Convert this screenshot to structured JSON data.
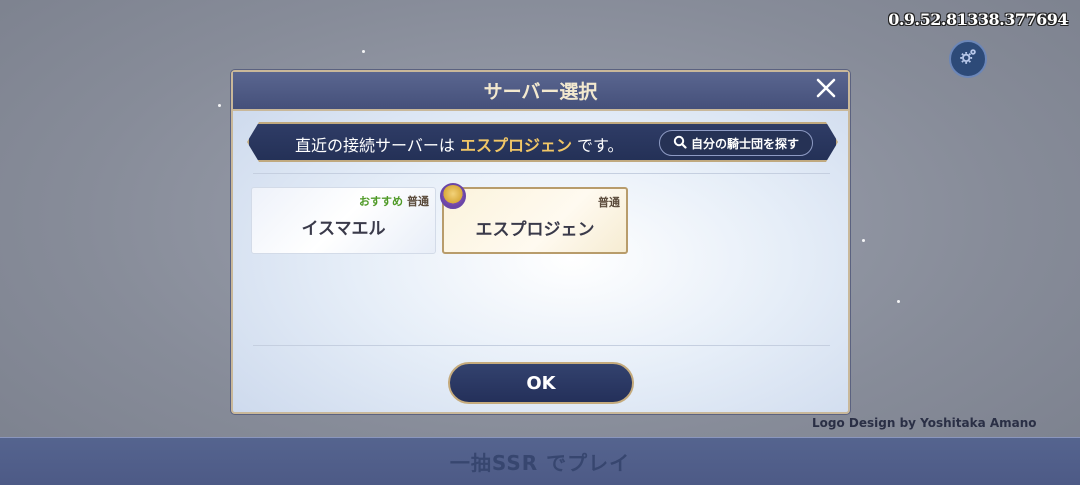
{
  "version": "0.9.52.81338.377694",
  "settings": {
    "icon": "gear-icon"
  },
  "dialog": {
    "title": "サーバー選択",
    "close_icon": "close-icon",
    "info": {
      "prefix": "直近の接続サーバーは",
      "server": "エスプロジェン",
      "suffix": "です。"
    },
    "search_button": {
      "icon": "search-icon",
      "label": "自分の騎士団を探す"
    },
    "servers": [
      {
        "name": "イスマエル",
        "recommended": "おすすめ",
        "status": "普通",
        "selected": false
      },
      {
        "name": "エスプロジェン",
        "recommended": "",
        "status": "普通",
        "selected": true,
        "has_avatar": true
      }
    ],
    "ok_label": "OK"
  },
  "footer": {
    "logo_credit": "Logo Design by Yoshitaka Amano",
    "banner_text": "一抽SSR でプレイ"
  }
}
